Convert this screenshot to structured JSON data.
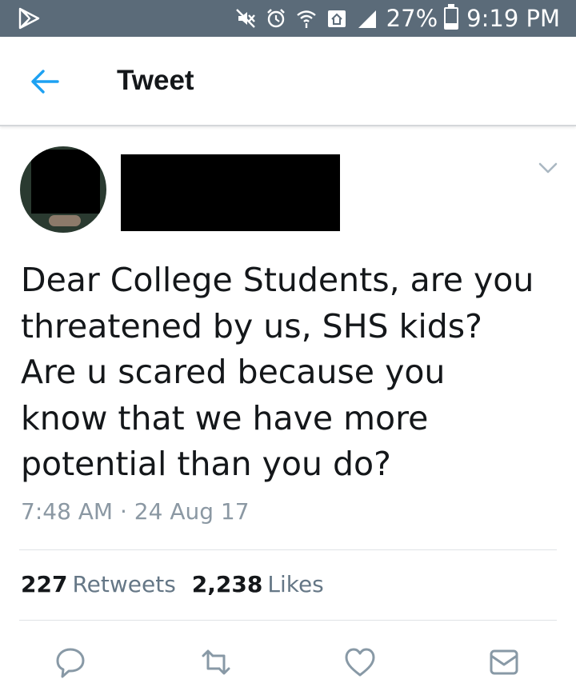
{
  "status_bar": {
    "battery": "27%",
    "battery_level": 0.27,
    "time": "9:19 PM",
    "icons": [
      "play-store-icon",
      "mute-icon",
      "alarm-icon",
      "wifi-icon",
      "home-icon",
      "signal-icon",
      "battery-icon"
    ]
  },
  "header": {
    "title": "Tweet",
    "back_icon": "arrow-left-icon"
  },
  "tweet": {
    "text": "Dear College Students, are you\nthreatened by us, SHS kids?\nAre u scared because you\nknow that we have more\npotential than you do?",
    "timestamp": "7:48 AM · 24 Aug 17",
    "retweets_count": "227",
    "retweets_label": "Retweets",
    "likes_count": "2,238",
    "likes_label": "Likes"
  },
  "actions": [
    "reply-icon",
    "retweet-icon",
    "like-icon",
    "message-icon"
  ],
  "colors": {
    "status_bar": "#5b6b79",
    "accent": "#1da1f2",
    "icon_gray": "#8899a6",
    "muted_text": "#8b98a3"
  }
}
